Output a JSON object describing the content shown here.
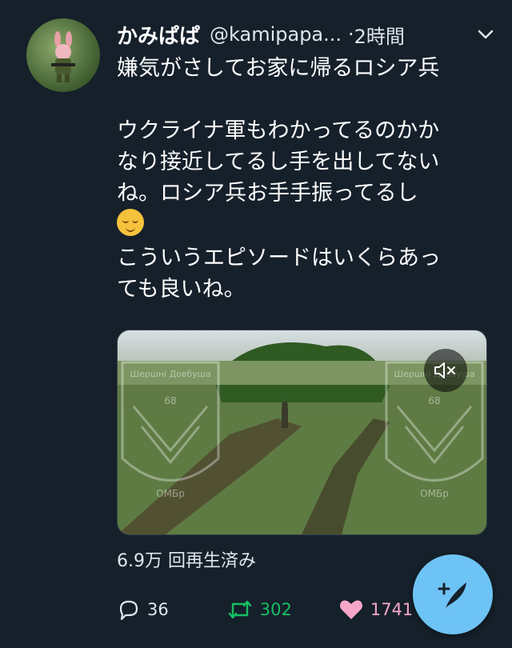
{
  "tweet": {
    "display_name": "かみぱぱ",
    "handle": "@kamipapa...",
    "separator": "·",
    "time": "2時間",
    "body_line1": "嫌気がさしてお家に帰るロシア兵",
    "body_para2": "ウクライナ軍もわかってるのかか\nなり接近してるし手を出してない\nね。ロシア兵お手手振ってるし",
    "body_para3": "こういうエピソードはいくらあっ\nても良いね。",
    "emoji": "relieved-face",
    "video_patch_text": "Шершні Довбуша",
    "video_patch_number": "68",
    "video_patch_bottom": "OMБр",
    "views": "6.9万 回再生済み",
    "replies": "36",
    "retweets": "302",
    "likes": "1741"
  },
  "colors": {
    "background": "#15202b",
    "retweet": "#17bf63",
    "like": "#f6a7c8",
    "fab": "#6ec3f5"
  }
}
